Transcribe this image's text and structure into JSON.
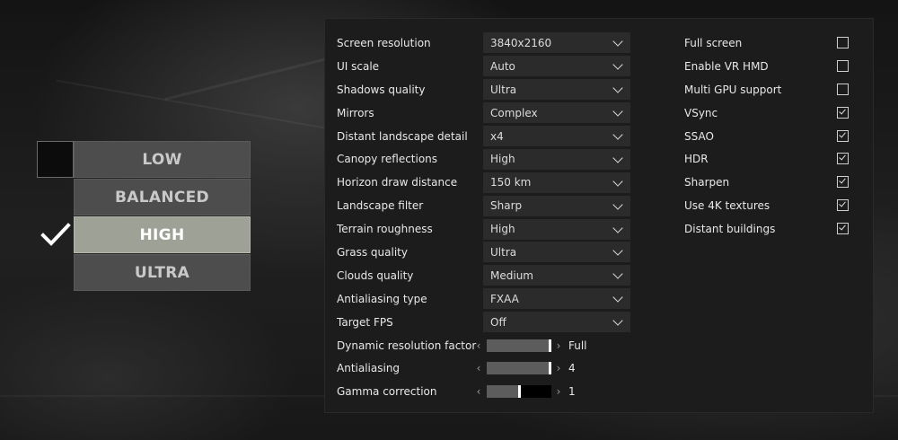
{
  "presets": [
    {
      "label": "LOW",
      "selected": false
    },
    {
      "label": "BALANCED",
      "selected": false
    },
    {
      "label": "HIGH",
      "selected": true
    },
    {
      "label": "ULTRA",
      "selected": false
    }
  ],
  "selects": [
    {
      "label": "Screen resolution",
      "value": "3840x2160"
    },
    {
      "label": "UI scale",
      "value": "Auto"
    },
    {
      "label": "Shadows quality",
      "value": "Ultra"
    },
    {
      "label": "Mirrors",
      "value": "Complex"
    },
    {
      "label": "Distant landscape detail",
      "value": "x4"
    },
    {
      "label": "Canopy reflections",
      "value": "High"
    },
    {
      "label": "Horizon draw distance",
      "value": "150 km"
    },
    {
      "label": "Landscape filter",
      "value": "Sharp"
    },
    {
      "label": "Terrain roughness",
      "value": "High"
    },
    {
      "label": "Grass quality",
      "value": "Ultra"
    },
    {
      "label": "Clouds quality",
      "value": "Medium"
    },
    {
      "label": "Antialiasing type",
      "value": "FXAA"
    },
    {
      "label": "Target FPS",
      "value": "Off"
    }
  ],
  "sliders": [
    {
      "label": "Dynamic resolution factor",
      "value": "Full",
      "level": 1.0
    },
    {
      "label": "Antialiasing",
      "value": "4",
      "level": 1.0
    },
    {
      "label": "Gamma correction",
      "value": "1",
      "level": 0.5
    }
  ],
  "arrows": {
    "left": "‹",
    "right": "›"
  },
  "toggles": [
    {
      "label": "Full screen",
      "checked": false
    },
    {
      "label": "Enable VR HMD",
      "checked": false
    },
    {
      "label": "Multi GPU support",
      "checked": false
    },
    {
      "label": "VSync",
      "checked": true
    },
    {
      "label": "SSAO",
      "checked": true
    },
    {
      "label": "HDR",
      "checked": true
    },
    {
      "label": "Sharpen",
      "checked": true
    },
    {
      "label": "Use 4K textures",
      "checked": true
    },
    {
      "label": "Distant buildings",
      "checked": true
    }
  ],
  "icons": {
    "selected_marker": "checkmark-icon",
    "dropdown": "chevron-down-icon",
    "checkbox_mark": "checkmark-icon"
  },
  "colors": {
    "selected_preset_bg": "#9ea196",
    "preset_bg": "#4d4d4d",
    "panel_bg": "#1c1c1c",
    "select_bg": "#2b2b2b",
    "slider_track": "#000000",
    "slider_fill": "#5c5c5c"
  }
}
